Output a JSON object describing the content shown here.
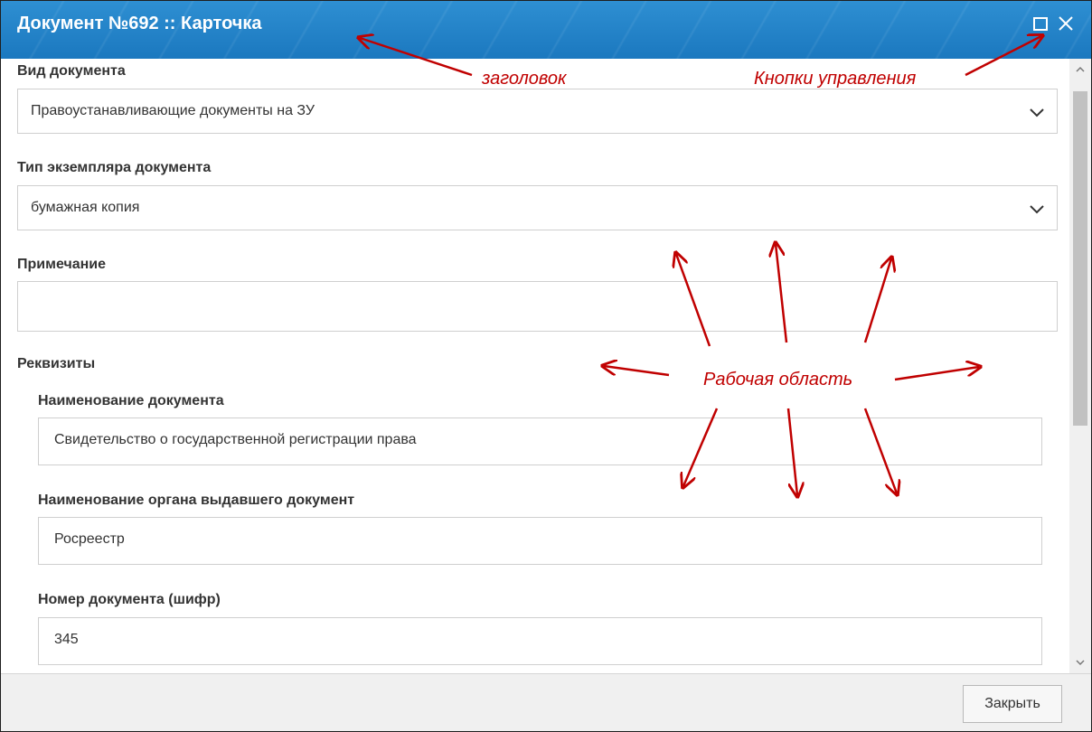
{
  "window": {
    "title": "Документ №692 :: Карточка",
    "accent_color": "#1e7dc4",
    "controls": {
      "maximize_icon": "maximize-icon",
      "close_icon": "close-icon"
    }
  },
  "form": {
    "doc_type": {
      "label": "Вид документа",
      "value": "Правоустанавливающие документы на ЗУ"
    },
    "copy_type": {
      "label": "Тип экземпляра документа",
      "value": "бумажная копия"
    },
    "note": {
      "label": "Примечание",
      "value": ""
    },
    "requisites": {
      "label": "Реквизиты",
      "doc_name": {
        "label": "Наименование документа",
        "value": "Свидетельство о государственной регистрации права"
      },
      "issuer": {
        "label": "Наименование органа выдавшего документ",
        "value": "Росреестр"
      },
      "number": {
        "label": "Номер документа (шифр)",
        "value": "345"
      }
    }
  },
  "footer": {
    "close_label": "Закрыть"
  },
  "annotations": {
    "header": "заголовок",
    "controls": "Кнопки управления",
    "workspace": "Рабочая область",
    "color": "#c00000"
  }
}
